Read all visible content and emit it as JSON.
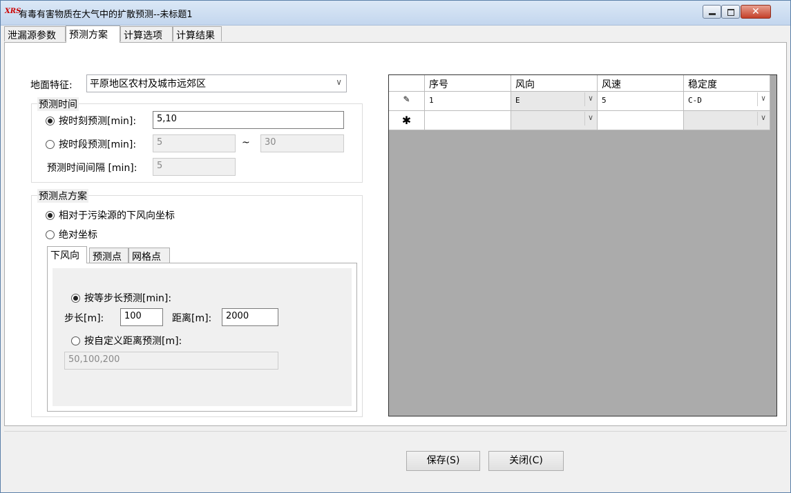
{
  "window": {
    "icon_text": "XRS",
    "title": "有毒有害物质在大气中的扩散预测--未标题1"
  },
  "tabs": [
    "泄漏源参数",
    "预测方案",
    "计算选项",
    "计算结果"
  ],
  "ground": {
    "label": "地面特征:",
    "value": "平原地区农村及城市远郊区"
  },
  "time_group": {
    "title": "预测时间",
    "by_moment_label": "按时刻预测[min]:",
    "by_moment_value": "5,10",
    "by_moment_checked": true,
    "by_period_label": "按时段预测[min]:",
    "period_from": "5",
    "period_sep": "~",
    "period_to": "30",
    "interval_label": "预测时间间隔 [min]:",
    "interval_value": "5"
  },
  "point_group": {
    "title": "预测点方案",
    "relative_label": "相对于污染源的下风向坐标",
    "relative_checked": true,
    "absolute_label": "绝对坐标",
    "subtabs": [
      "下风向",
      "预测点",
      "网格点"
    ],
    "equal_step_label": "按等步长预测[min]:",
    "step_label": "步长[m]:",
    "step_value": "100",
    "distance_label": "距离[m]:",
    "distance_value": "2000",
    "custom_label": "按自定义距离预测[m]:",
    "custom_value": "50,100,200"
  },
  "grid": {
    "columns": [
      "序号",
      "风向",
      "风速",
      "稳定度"
    ],
    "row1": {
      "seq": "1",
      "dir": "E",
      "speed": "5",
      "stability": "C-D"
    },
    "row_edit_glyph": "✎",
    "row_new_glyph": "✱"
  },
  "buttons": {
    "save": "保存(S)",
    "close": "关闭(C)"
  }
}
